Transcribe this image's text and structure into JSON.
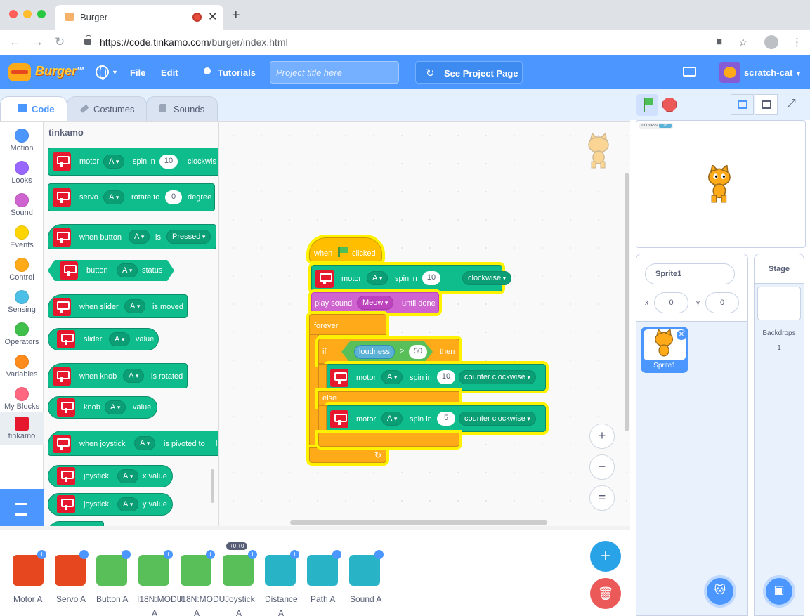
{
  "browser": {
    "tab_title": "Burger",
    "url_host": "https://code.tinkamo.com",
    "url_path": "/burger/index.html",
    "new_tab": "+",
    "close": "✕"
  },
  "menubar": {
    "logo_text": "Burger",
    "logo_tm": "TM",
    "file": "File",
    "edit": "Edit",
    "tutorials": "Tutorials",
    "project_title_placeholder": "Project title here",
    "see_project_page": "See Project Page",
    "username": "scratch-cat"
  },
  "tabs": {
    "code": "Code",
    "costumes": "Costumes",
    "sounds": "Sounds"
  },
  "categories": [
    {
      "label": "Motion",
      "color": "#4c97ff"
    },
    {
      "label": "Looks",
      "color": "#9966ff"
    },
    {
      "label": "Sound",
      "color": "#cf63cf"
    },
    {
      "label": "Events",
      "color": "#ffd500"
    },
    {
      "label": "Control",
      "color": "#ffab19"
    },
    {
      "label": "Sensing",
      "color": "#4cbfe6"
    },
    {
      "label": "Operators",
      "color": "#40bf4a"
    },
    {
      "label": "Variables",
      "color": "#ff8c1a"
    },
    {
      "label": "My Blocks",
      "color": "#ff6680"
    },
    {
      "label": "tinkamo",
      "color": "#e6182d"
    }
  ],
  "palette": {
    "title": "tinkamo",
    "motor_spin": {
      "t1": "motor",
      "dd": "A",
      "t2": "spin in",
      "num": "10",
      "t3": "clockwis"
    },
    "servo": {
      "t1": "servo",
      "dd": "A",
      "t2": "rotate to",
      "num": "0",
      "t3": "degree"
    },
    "when_button": {
      "t1": "when button",
      "dd": "A",
      "t2": "is",
      "dd2": "Pressed"
    },
    "button_status": {
      "t1": "button",
      "dd": "A",
      "t2": "status"
    },
    "when_slider": {
      "t1": "when slider",
      "dd": "A",
      "t2": "is moved"
    },
    "slider_value": {
      "t1": "slider",
      "dd": "A",
      "t2": "value"
    },
    "when_knob": {
      "t1": "when knob",
      "dd": "A",
      "t2": "is rotated"
    },
    "knob_value": {
      "t1": "knob",
      "dd": "A",
      "t2": "value"
    },
    "when_joystick": {
      "t1": "when joystick",
      "dd": "A",
      "t2": "is pivoted to",
      "t3": "le"
    },
    "joystick_x": {
      "t1": "joystick",
      "dd": "A",
      "t2": "x value"
    },
    "joystick_y": {
      "t1": "joystick",
      "dd": "A",
      "t2": "y value"
    }
  },
  "script": {
    "when": "when",
    "clicked": "clicked",
    "motor1": {
      "t1": "motor",
      "dd": "A",
      "t2": "spin in",
      "num": "10",
      "dir": "clockwise"
    },
    "play_sound": {
      "t1": "play sound",
      "dd": "Meow",
      "t2": "until done"
    },
    "forever": "forever",
    "if": "if",
    "loudness": "loudness",
    "gt": ">",
    "threshold": "50",
    "then": "then",
    "motor2": {
      "t1": "motor",
      "dd": "A",
      "t2": "spin in",
      "num": "10",
      "dir": "counter clockwise"
    },
    "else": "else",
    "motor3": {
      "t1": "motor",
      "dd": "A",
      "t2": "spin in",
      "num": "5",
      "dir": "counter clockwise"
    },
    "loop_arrow": "↻"
  },
  "zoom": {
    "in": "+",
    "out": "−",
    "reset": "="
  },
  "stage": {
    "monitor_label": "loudness",
    "monitor_value": "28"
  },
  "sprite": {
    "name": "Sprite1",
    "x_label": "x",
    "x": "0",
    "y_label": "y",
    "y": "0",
    "thumb_label": "Sprite1"
  },
  "stage_pane": {
    "title": "Stage",
    "backdrops_label": "Backdrops",
    "backdrops_count": "1"
  },
  "devices": [
    {
      "label": "Motor A",
      "color": "#e6471e"
    },
    {
      "label": "Servo A",
      "color": "#e6471e"
    },
    {
      "label": "Button A",
      "color": "#59c059"
    },
    {
      "label": "I18N:MODU",
      "sub": "A",
      "color": "#59c059"
    },
    {
      "label": "I18N:MODU",
      "sub": "A",
      "color": "#59c059"
    },
    {
      "label": "Joystick",
      "sub": "A",
      "color": "#59c059"
    },
    {
      "label": "Distance",
      "sub": "A",
      "color": "#29b3c7"
    },
    {
      "label": "Path A",
      "color": "#29b3c7"
    },
    {
      "label": "Sound A",
      "color": "#29b3c7"
    }
  ],
  "device_tooltip": "+0 +0"
}
